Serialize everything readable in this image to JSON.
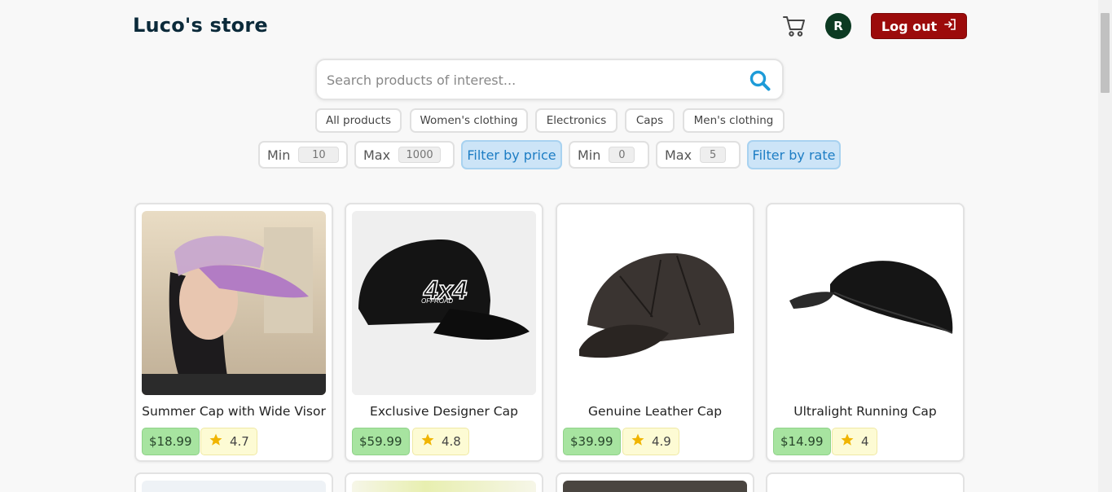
{
  "header": {
    "brand": "Luco's store",
    "avatar_initial": "R",
    "logout_label": "Log out"
  },
  "search": {
    "placeholder": "Search products of interest...",
    "value": ""
  },
  "categories": [
    "All products",
    "Women's clothing",
    "Electronics",
    "Caps",
    "Men's clothing"
  ],
  "filters": {
    "price": {
      "min_label": "Min",
      "min_value": "10",
      "max_label": "Max",
      "max_value": "1000",
      "button": "Filter by price"
    },
    "rate": {
      "min_label": "Min",
      "min_value": "0",
      "max_label": "Max",
      "max_value": "5",
      "button": "Filter by rate"
    }
  },
  "products": [
    {
      "title": "Summer Cap with Wide Visor",
      "price": "$18.99",
      "rating": "4.7"
    },
    {
      "title": "Exclusive Designer Cap",
      "price": "$59.99",
      "rating": "4.8"
    },
    {
      "title": "Genuine Leather Cap",
      "price": "$39.99",
      "rating": "4.9"
    },
    {
      "title": "Ultralight Running Cap",
      "price": "$14.99",
      "rating": "4"
    }
  ],
  "colors": {
    "brand": "#0b2a3a",
    "logout_bg": "#9c0b0b",
    "avatar_bg": "#0c3a22",
    "accent_blue": "#1d9bd8",
    "price_bg": "#a7e4a0",
    "rating_bg": "#fdfbd4",
    "star": "#f0b400"
  },
  "icons": {
    "cart": "cart-icon",
    "search": "search-icon",
    "logout": "logout-icon",
    "star": "star-icon"
  }
}
